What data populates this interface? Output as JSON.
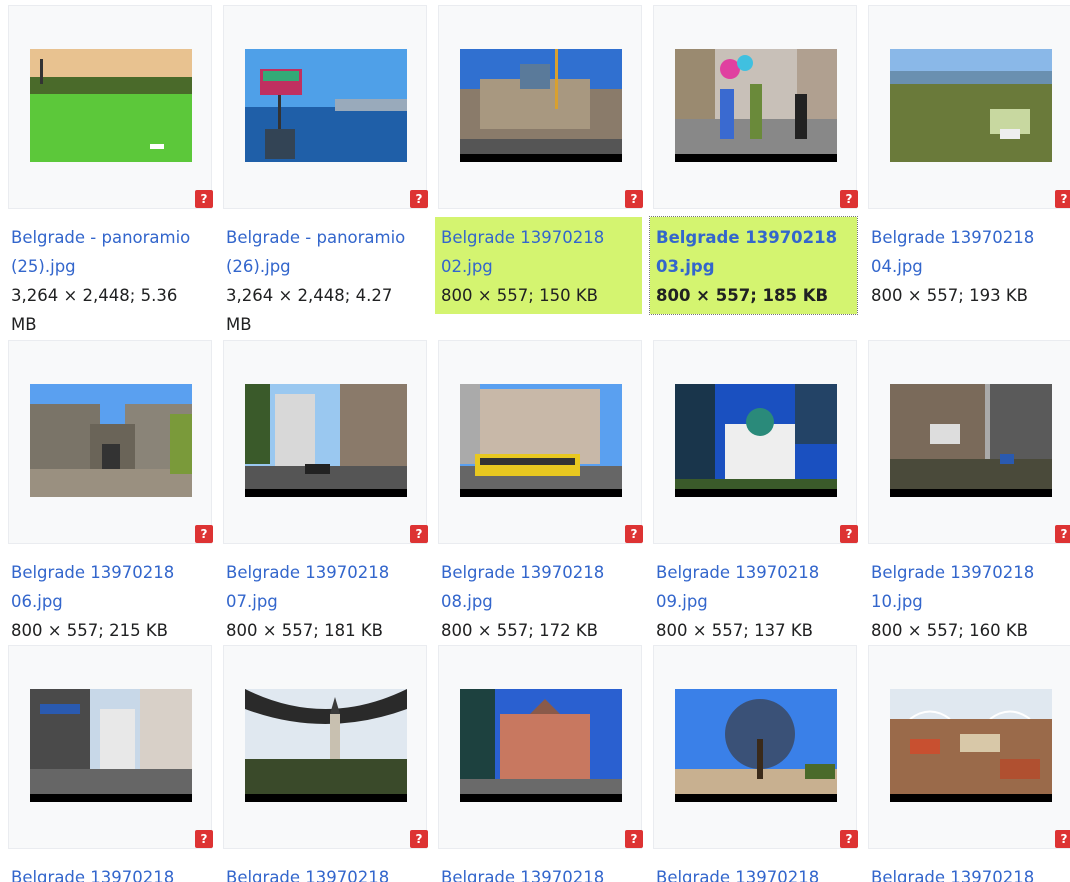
{
  "gallery": {
    "items": [
      {
        "title": "Belgrade - panoramio (25).jpg",
        "meta": "3,264 × 2,448; 5.36 MB",
        "state": "normal",
        "scene": "river-green"
      },
      {
        "title": "Belgrade - panoramio (26).jpg",
        "meta": "3,264 × 2,448; 4.27 MB",
        "state": "normal",
        "scene": "river-blue"
      },
      {
        "title": "Belgrade 13970218 02.jpg",
        "meta": "800 × 557; 150 KB",
        "state": "highlight",
        "scene": "building-square"
      },
      {
        "title": "Belgrade 13970218 03.jpg",
        "meta": "800 × 557; 185 KB",
        "state": "current",
        "scene": "street-people"
      },
      {
        "title": "Belgrade 13970218 04.jpg",
        "meta": "800 × 557; 193 KB",
        "state": "normal",
        "scene": "park-aerial"
      },
      {
        "title": "Belgrade 13970218 06.jpg",
        "meta": "800 × 557; 215 KB",
        "state": "normal",
        "scene": "fortress"
      },
      {
        "title": "Belgrade 13970218 07.jpg",
        "meta": "800 × 557; 181 KB",
        "state": "normal",
        "scene": "street-buildings"
      },
      {
        "title": "Belgrade 13970218 08.jpg",
        "meta": "800 × 557; 172 KB",
        "state": "normal",
        "scene": "yellow-bus"
      },
      {
        "title": "Belgrade 13970218 09.jpg",
        "meta": "800 × 557; 137 KB",
        "state": "normal",
        "scene": "temple"
      },
      {
        "title": "Belgrade 13970218 10.jpg",
        "meta": "800 × 557; 160 KB",
        "state": "normal",
        "scene": "alley"
      },
      {
        "title": "Belgrade 13970218",
        "meta": "",
        "state": "normal",
        "scene": "street-shops"
      },
      {
        "title": "Belgrade 13970218",
        "meta": "",
        "state": "normal",
        "scene": "church-tree"
      },
      {
        "title": "Belgrade 13970218",
        "meta": "",
        "state": "normal",
        "scene": "palace"
      },
      {
        "title": "Belgrade 13970218",
        "meta": "",
        "state": "normal",
        "scene": "big-tree"
      },
      {
        "title": "Belgrade 13970218",
        "meta": "",
        "state": "normal",
        "scene": "rooftops"
      }
    ],
    "warning_badge": "?",
    "warning_icon": "question-mark-badge-icon",
    "colors": {
      "link": "#3366cc",
      "highlight": "#d4f470",
      "badge": "#dd3333"
    }
  }
}
